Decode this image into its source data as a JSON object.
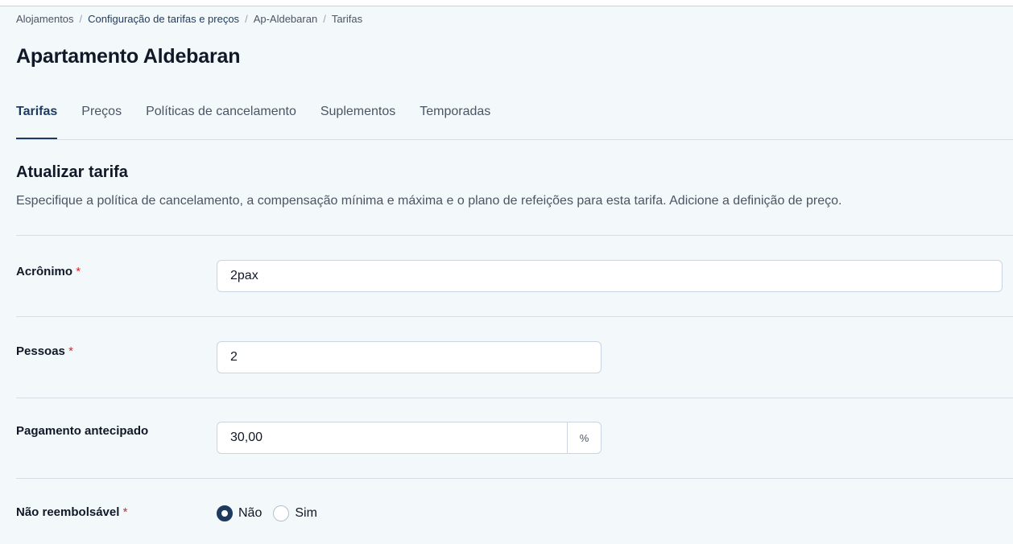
{
  "breadcrumb": {
    "items": [
      {
        "label": "Alojamentos"
      },
      {
        "label": "Configuração de tarifas e preços"
      },
      {
        "label": "Ap-Aldebaran"
      },
      {
        "label": "Tarifas"
      }
    ],
    "separator": "/"
  },
  "page": {
    "title": "Apartamento Aldebaran"
  },
  "tabs": [
    {
      "label": "Tarifas",
      "active": true
    },
    {
      "label": "Preços",
      "active": false
    },
    {
      "label": "Políticas de cancelamento",
      "active": false
    },
    {
      "label": "Suplementos",
      "active": false
    },
    {
      "label": "Temporadas",
      "active": false
    }
  ],
  "section": {
    "title": "Atualizar tarifa",
    "description": "Especifique a política de cancelamento, a compensação mínima e máxima e o plano de refeições para esta tarifa. Adicione a definição de preço."
  },
  "form": {
    "acronym": {
      "label": "Acrônimo",
      "required_mark": "*",
      "value": "2pax"
    },
    "persons": {
      "label": "Pessoas",
      "required_mark": "*",
      "value": "2"
    },
    "prepayment": {
      "label": "Pagamento antecipado",
      "value": "30,00",
      "addon": "%"
    },
    "non_refundable": {
      "label": "Não reembolsável",
      "required_mark": "*",
      "options": [
        {
          "label": "Não",
          "selected": true
        },
        {
          "label": "Sim",
          "selected": false
        }
      ]
    }
  },
  "colors": {
    "accent": "#1e3a5f",
    "required": "#dc2626",
    "background": "#f3f8fb"
  }
}
